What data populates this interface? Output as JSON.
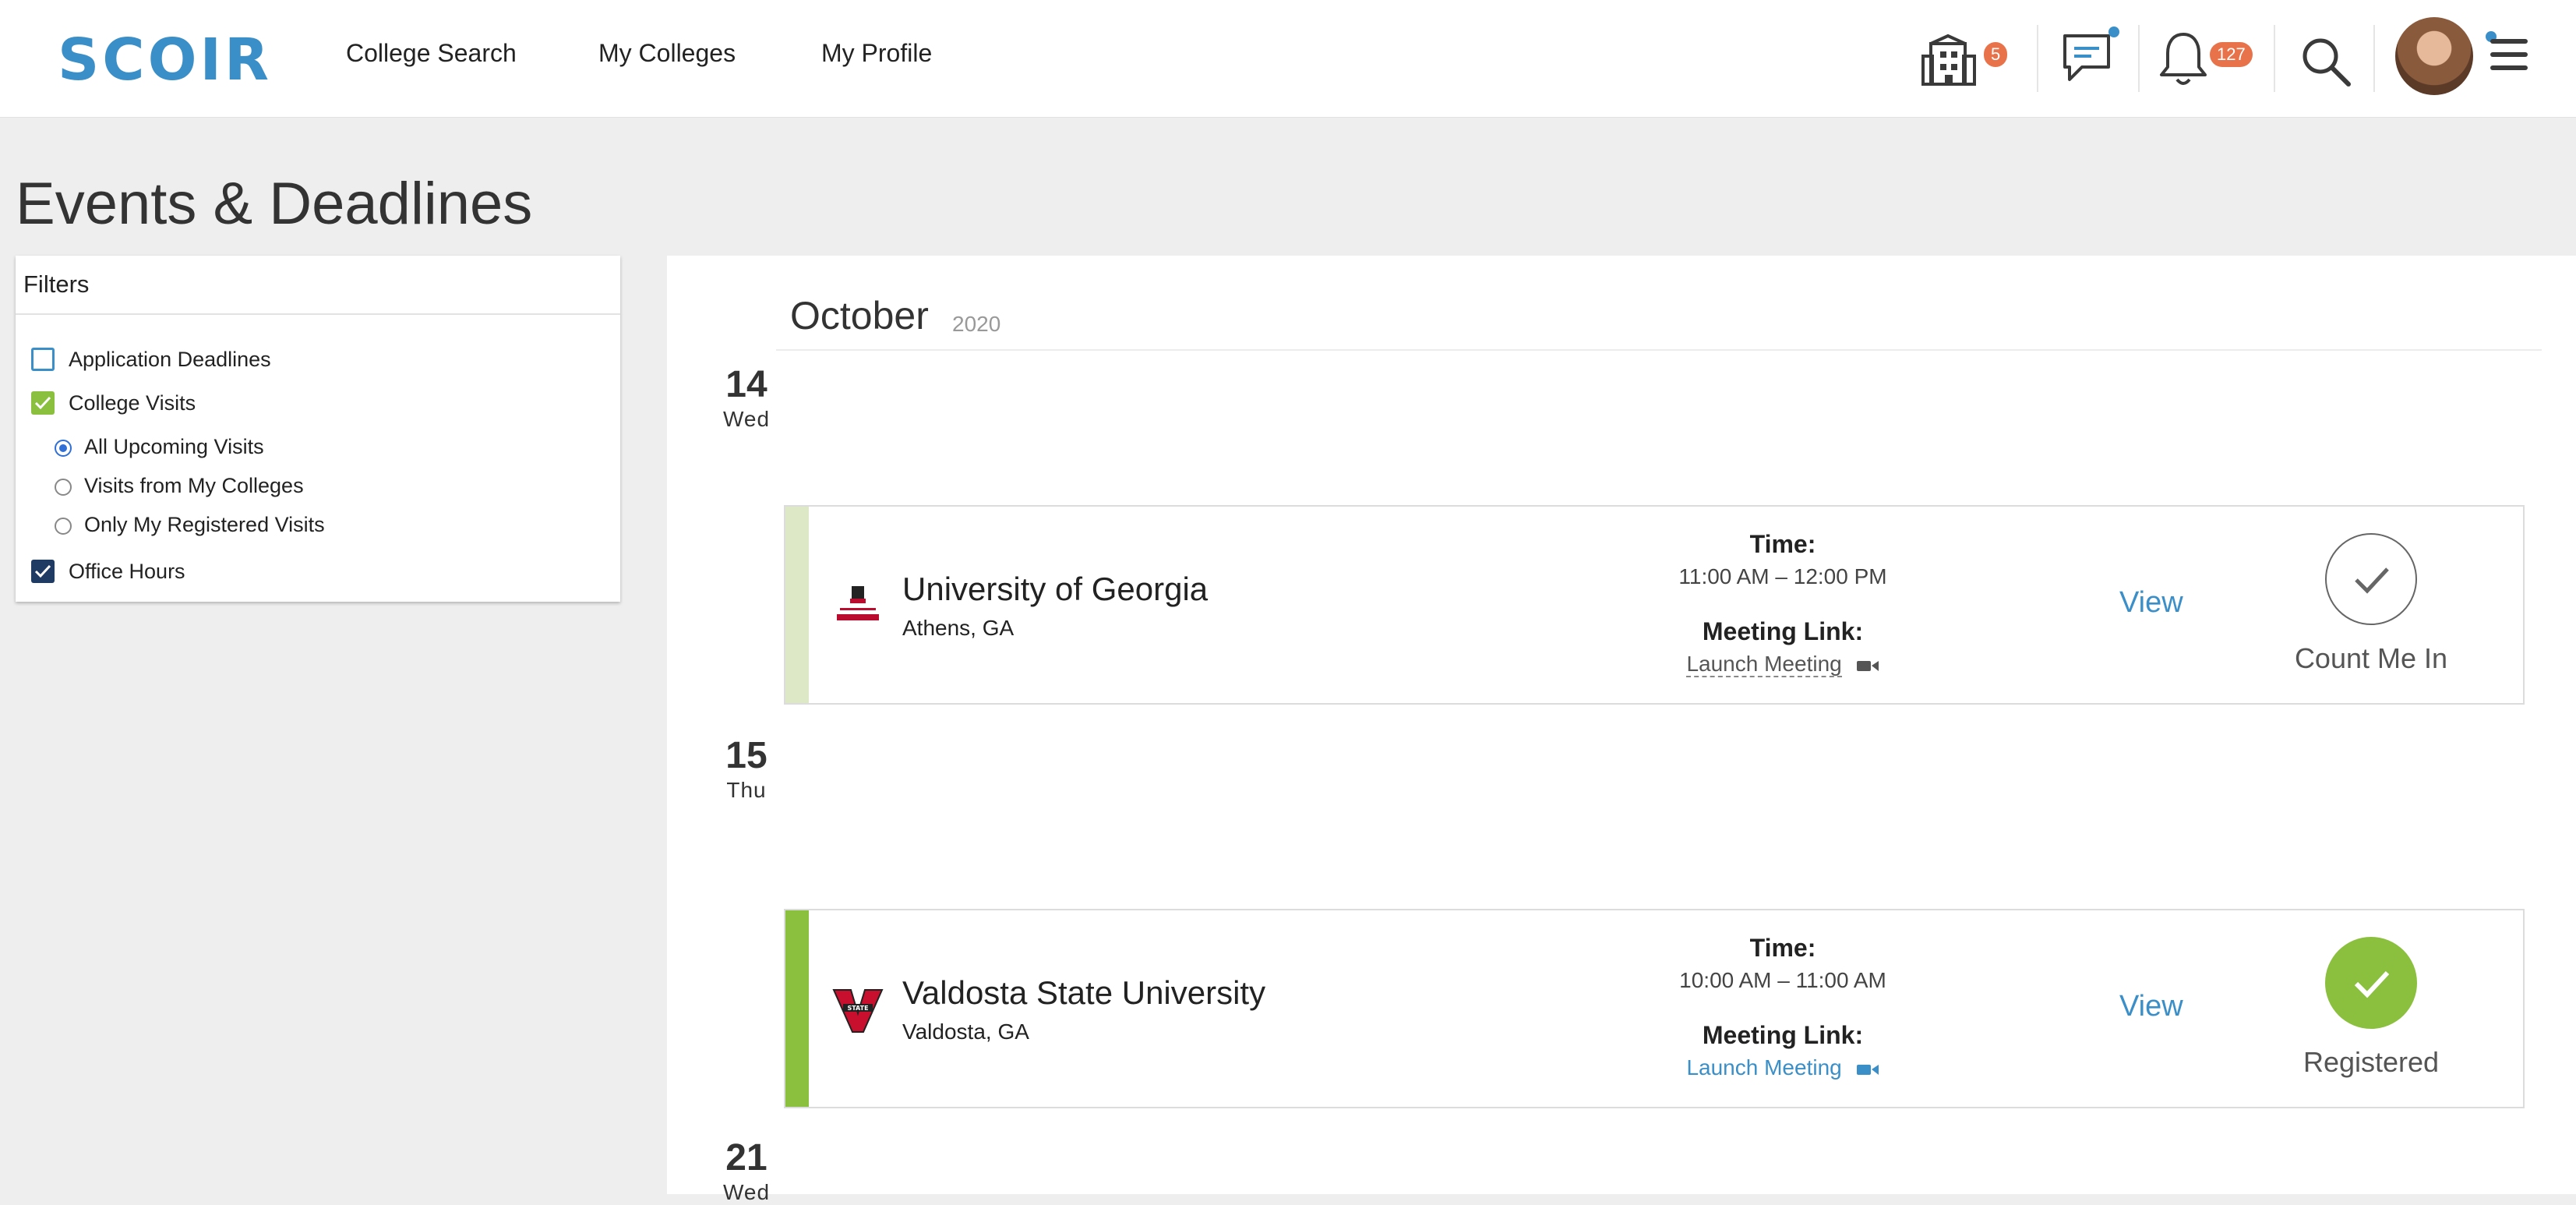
{
  "header": {
    "logo_text": "SCOIR",
    "nav": [
      "College Search",
      "My Colleges",
      "My Profile"
    ],
    "colleges_badge": "5",
    "notifications_badge": "127",
    "icons": [
      "building-icon",
      "chat-icon",
      "bell-icon",
      "search-icon",
      "avatar",
      "menu-icon"
    ]
  },
  "page": {
    "title": "Events & Deadlines"
  },
  "filters": {
    "title": "Filters",
    "application_deadlines": {
      "label": "Application Deadlines",
      "checked": false
    },
    "college_visits": {
      "label": "College Visits",
      "checked": true
    },
    "visit_options": [
      {
        "label": "All Upcoming Visits",
        "selected": true
      },
      {
        "label": "Visits from My Colleges",
        "selected": false
      },
      {
        "label": "Only My Registered Visits",
        "selected": false
      }
    ],
    "office_hours": {
      "label": "Office Hours",
      "checked": true
    }
  },
  "calendar": {
    "month": "October",
    "year": "2020",
    "days": [
      {
        "num": "14",
        "name": "Wed"
      },
      {
        "num": "15",
        "name": "Thu"
      },
      {
        "num": "21",
        "name": "Wed"
      }
    ],
    "events": [
      {
        "school": "University of Georgia",
        "location": "Athens, GA",
        "time_label": "Time:",
        "time": "11:00 AM – 12:00 PM",
        "meeting_label": "Meeting Link:",
        "meeting_link": "Launch Meeting",
        "view": "View",
        "action": "Count Me In",
        "registered": false
      },
      {
        "school": "Valdosta State University",
        "location": "Valdosta, GA",
        "time_label": "Time:",
        "time": "10:00 AM – 11:00 AM",
        "meeting_label": "Meeting Link:",
        "meeting_link": "Launch Meeting",
        "view": "View",
        "action": "Registered",
        "registered": true
      }
    ]
  },
  "colors": {
    "brand_blue": "#3a8fc9",
    "badge_orange": "#e8734a",
    "registered_green": "#8bbf3e",
    "pending_green": "#dde8c6",
    "checkbox_navy": "#1f3b63"
  }
}
